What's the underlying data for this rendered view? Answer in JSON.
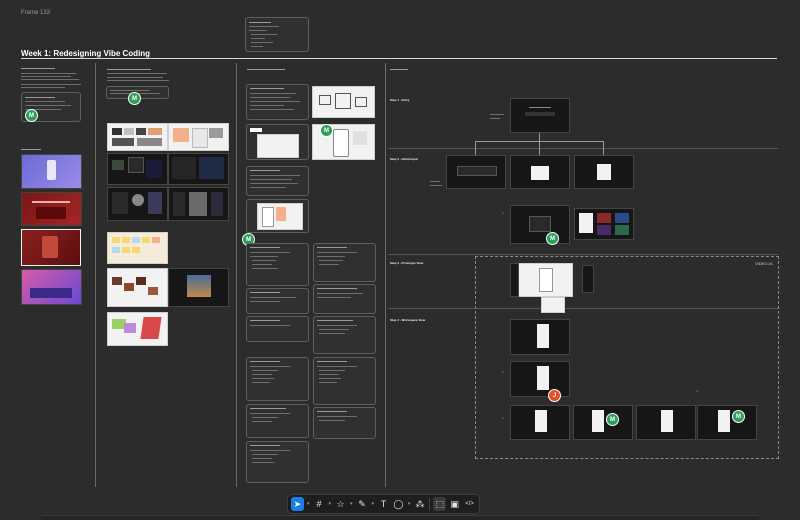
{
  "frame": {
    "label": "Frame 133"
  },
  "page": {
    "title": "Week 1: Redesigning Vibe Coding"
  },
  "video": {
    "label": "VIDEO #1"
  },
  "steps": [
    {
      "label": "Step 1 - Entry"
    },
    {
      "label": "Step 2 - Initial Input"
    },
    {
      "label": "Step 3 - Prototype View"
    },
    {
      "label": "Step 4 - Workspace View"
    }
  ],
  "avatars": {
    "m": "M",
    "j": "J"
  },
  "toolbar": {
    "tools": [
      {
        "name": "move-tool",
        "icon": "cursor-icon",
        "glyph": "➤",
        "active": true
      },
      {
        "name": "frame-tool",
        "icon": "frame-icon",
        "glyph": "#",
        "active": false
      },
      {
        "name": "shape-tool",
        "icon": "star-icon",
        "glyph": "☆",
        "active": false
      },
      {
        "name": "pen-tool",
        "icon": "pen-icon",
        "glyph": "✎",
        "active": false
      },
      {
        "name": "text-tool",
        "icon": "text-icon",
        "glyph": "T",
        "active": false
      },
      {
        "name": "comment-tool",
        "icon": "comment-icon",
        "glyph": "◯",
        "active": false
      },
      {
        "name": "actions-tool",
        "icon": "actions-icon",
        "glyph": "⁂",
        "active": false
      }
    ],
    "modes": [
      {
        "name": "design-mode",
        "icon": "design-mode-icon",
        "glyph": "⬚"
      },
      {
        "name": "prototype-mode",
        "icon": "prototype-mode-icon",
        "glyph": "▣"
      },
      {
        "name": "dev-mode",
        "icon": "code-icon",
        "glyph": "</>"
      }
    ]
  },
  "colors": {
    "canvas": "#2c2c2c",
    "accent": "#1e7de6",
    "avatar_green": "#2e9e58",
    "avatar_red": "#e0502a"
  }
}
